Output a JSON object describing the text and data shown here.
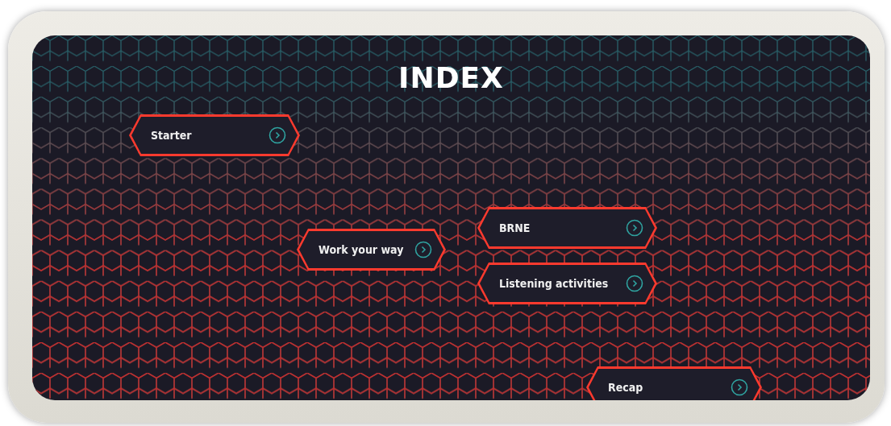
{
  "title": "INDEX",
  "items": [
    {
      "label": "Starter"
    },
    {
      "label": "Work your way"
    },
    {
      "label": "BRNE"
    },
    {
      "label": "Listening activities"
    },
    {
      "label": "Recap"
    }
  ]
}
